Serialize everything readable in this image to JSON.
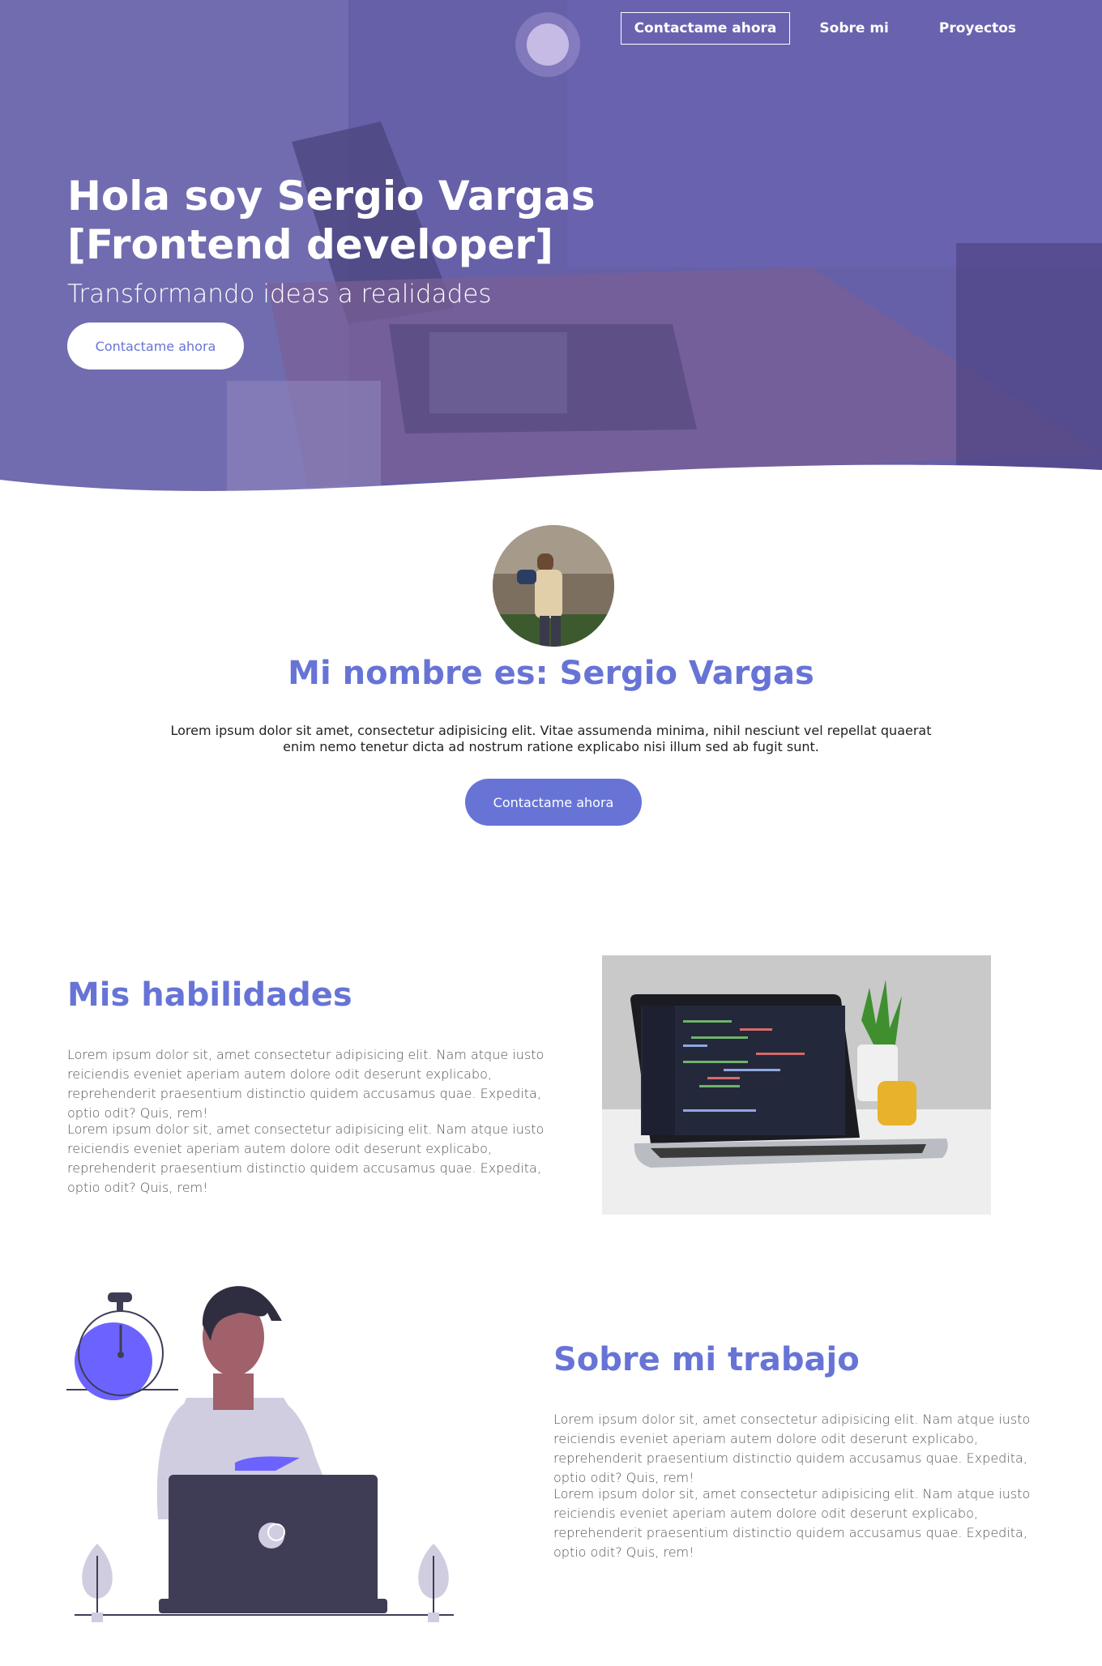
{
  "nav": {
    "contact": "Contactame ahora",
    "about": "Sobre mi",
    "projects": "Proyectos"
  },
  "hero": {
    "title": "Hola soy Sergio Vargas [Frontend developer]",
    "subtitle": "Transformando ideas a realidades",
    "cta": "Contactame ahora"
  },
  "about": {
    "title": "Mi nombre es: Sergio Vargas",
    "text": "Lorem ipsum dolor sit amet, consectetur adipisicing elit. Vitae assumenda minima, nihil nesciunt vel repellat quaerat enim nemo tenetur dicta ad nostrum ratione explicabo nisi illum sed ab fugit sunt.",
    "cta": "Contactame ahora"
  },
  "skills": {
    "title": "Mis habilidades",
    "p1": "Lorem ipsum dolor sit, amet consectetur adipisicing elit. Nam atque iusto reiciendis eveniet aperiam autem dolore odit deserunt explicabo, reprehenderit praesentium distinctio quidem accusamus quae. Expedita, optio odit? Quis, rem!",
    "p2": "Lorem ipsum dolor sit, amet consectetur adipisicing elit. Nam atque iusto reiciendis eveniet aperiam autem dolore odit deserunt explicabo, reprehenderit praesentium distinctio quidem accusamus quae. Expedita, optio odit? Quis, rem!"
  },
  "work": {
    "title": "Sobre mi trabajo",
    "p1": "Lorem ipsum dolor sit, amet consectetur adipisicing elit. Nam atque iusto reiciendis eveniet aperiam autem dolore odit deserunt explicabo, reprehenderit praesentium distinctio quidem accusamus quae. Expedita, optio odit? Quis, rem!",
    "p2": "Lorem ipsum dolor sit, amet consectetur adipisicing elit. Nam atque iusto reiciendis eveniet aperiam autem dolore odit deserunt explicabo, reprehenderit praesentium distinctio quidem accusamus quae. Expedita, optio odit? Quis, rem!"
  },
  "colors": {
    "accent": "#6774d6",
    "hero_overlay": "#6b66b0"
  }
}
